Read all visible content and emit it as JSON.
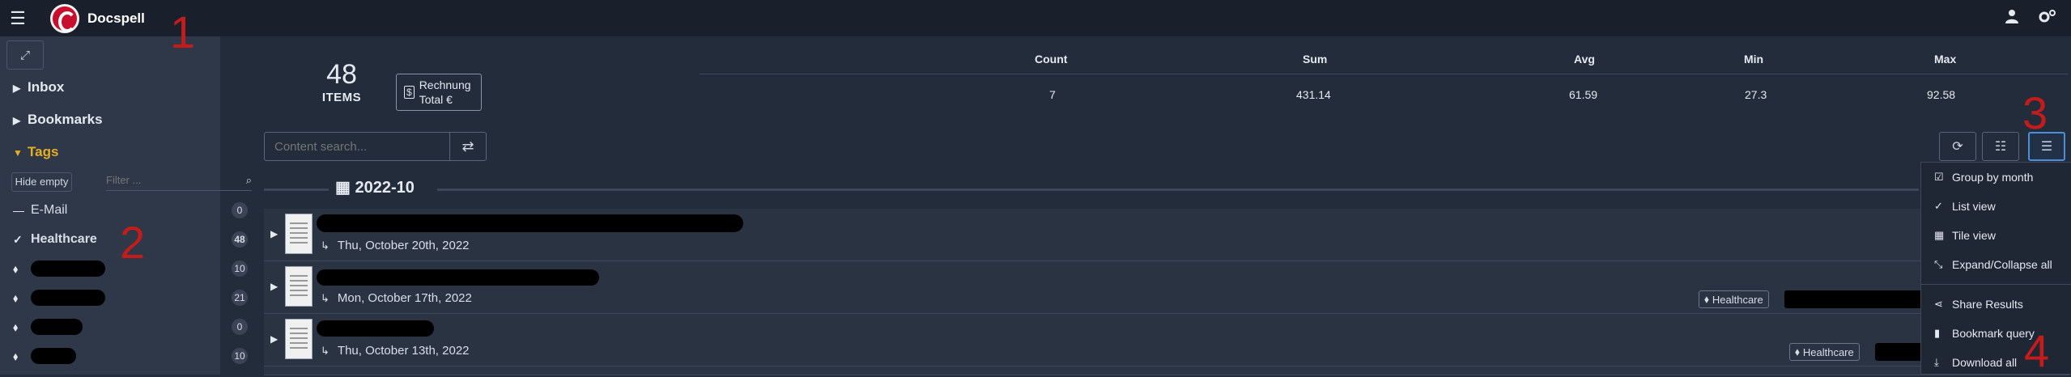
{
  "app": {
    "name": "Docspell"
  },
  "annotations": [
    "1",
    "2",
    "3",
    "4"
  ],
  "sidebar": {
    "nav": [
      {
        "label": "Inbox"
      },
      {
        "label": "Bookmarks"
      },
      {
        "label": "Tags"
      }
    ],
    "hide_empty_label": "Hide empty",
    "filter_placeholder": "Filter ...",
    "tags": [
      {
        "label": "E-Mail",
        "count": "0"
      },
      {
        "label": "Healthcare",
        "count": "48"
      },
      {
        "label": "",
        "count": "10"
      },
      {
        "label": "",
        "count": "21"
      },
      {
        "label": "",
        "count": "0"
      },
      {
        "label": "",
        "count": "10"
      }
    ]
  },
  "summary": {
    "count_value": "48",
    "count_label": "ITEMS",
    "field_line1": "Rechnung",
    "field_line2": "Total €",
    "headers": [
      "Count",
      "Sum",
      "Avg",
      "Min",
      "Max"
    ],
    "values": [
      "7",
      "431.14",
      "61.59",
      "27.3",
      "92.58"
    ]
  },
  "search": {
    "placeholder": "Content search..."
  },
  "group": {
    "label": "2022-10"
  },
  "items": [
    {
      "date": "Thu, October 20th, 2022",
      "tag": ""
    },
    {
      "date": "Mon, October 17th, 2022",
      "tag": "Healthcare"
    },
    {
      "date": "Thu, October 13th, 2022",
      "tag": "Healthcare"
    }
  ],
  "menu": {
    "items": [
      {
        "label": "Group by month",
        "icon": "checkbox-checked-icon"
      },
      {
        "label": "List view",
        "icon": "check-icon"
      },
      {
        "label": "Tile view",
        "icon": "grid-icon"
      },
      {
        "label": "Expand/Collapse all",
        "icon": "collapse-icon"
      },
      {
        "label": "Share Results",
        "icon": "share-icon"
      },
      {
        "label": "Bookmark query",
        "icon": "bookmark-icon"
      },
      {
        "label": "Download all",
        "icon": "download-icon"
      }
    ]
  },
  "colors": {
    "background": "#232c3a",
    "sidebar": "#2e3848",
    "topbar": "#19202c",
    "accent_tags": "#e6ae22",
    "annotation": "#c41b1b",
    "active_border": "#4a8fd8"
  }
}
